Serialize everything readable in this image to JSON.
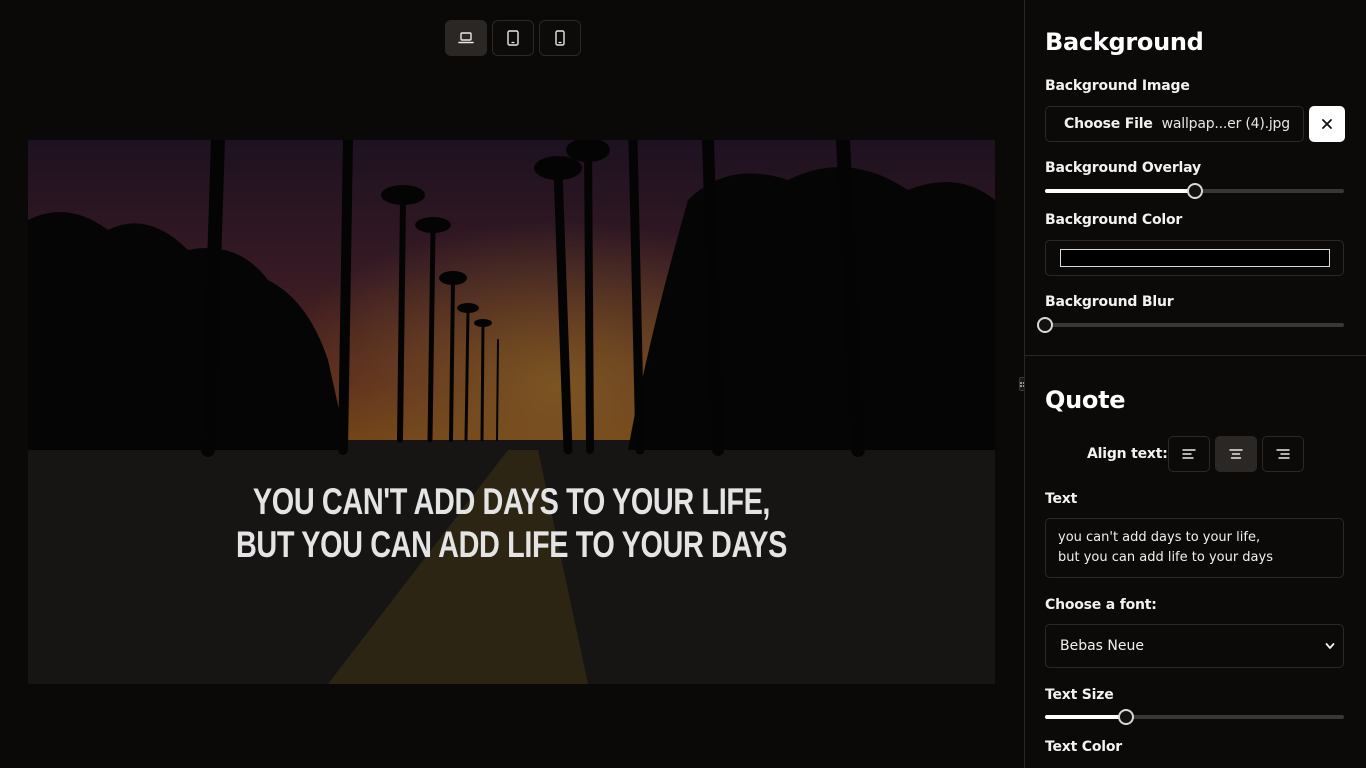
{
  "toolbar": {
    "devices": [
      {
        "name": "laptop-icon",
        "active": true
      },
      {
        "name": "tablet-icon",
        "active": false
      },
      {
        "name": "phone-icon",
        "active": false
      }
    ]
  },
  "canvas": {
    "quote": "You can't add days to your life,\nbut you can add life to your days"
  },
  "settings": {
    "background": {
      "title": "Background",
      "image_label": "Background Image",
      "choose_file_label": "Choose File",
      "file_name": "wallpap...er (4).jpg",
      "overlay_label": "Background Overlay",
      "overlay_value": 0.5,
      "color_label": "Background Color",
      "color_value": "#000000",
      "blur_label": "Background Blur",
      "blur_value": 0
    },
    "quote": {
      "title": "Quote",
      "align_label": "Align text:",
      "align_options": [
        "align-left-icon",
        "align-center-icon",
        "align-right-icon"
      ],
      "align_selected": "center",
      "text_label": "Text",
      "text_value": "you can't add days to your life,\nbut you can add life to your days",
      "font_label": "Choose a font:",
      "font_value": "Bebas Neue",
      "size_label": "Text Size",
      "size_value": 0.27,
      "color_label": "Text Color"
    }
  },
  "colors": {
    "page_bg": "#0b0908",
    "panel_bg": "#0c0a09",
    "border": "#2b2826",
    "active_btn": "#2a2725",
    "accent": "#ffffff"
  }
}
